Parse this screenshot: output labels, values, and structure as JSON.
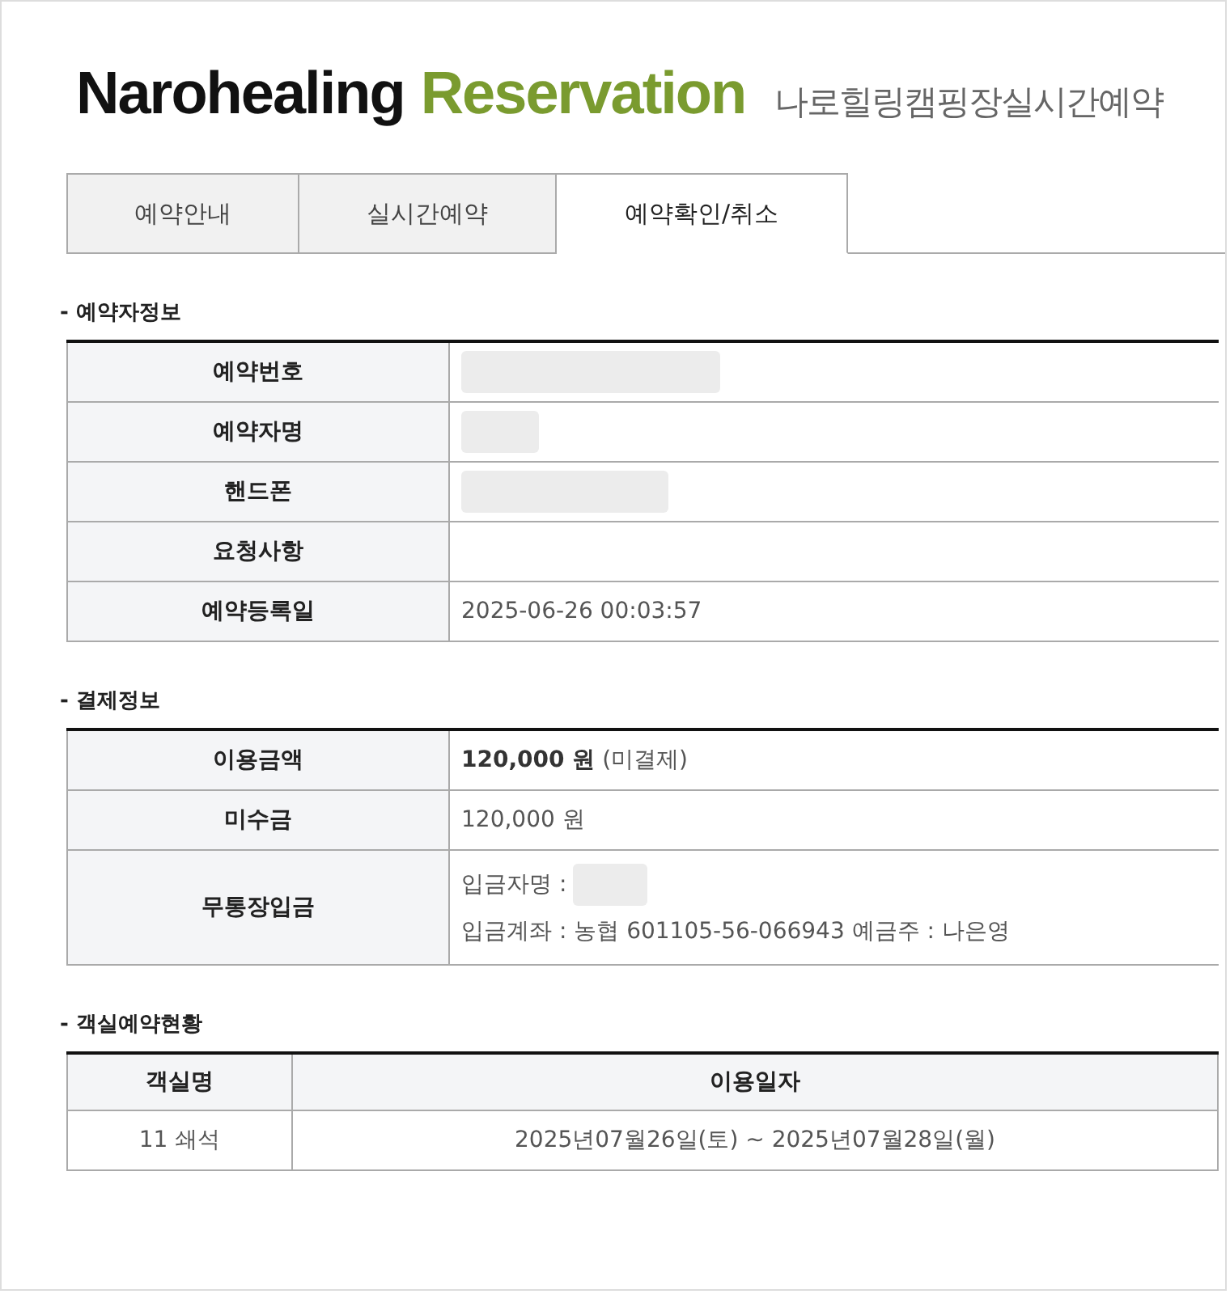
{
  "header": {
    "brand_primary": "Narohealing",
    "brand_secondary": "Reservation",
    "subtitle": "나로힐링캠핑장실시간예약"
  },
  "tabs": [
    {
      "label": "예약안내",
      "selected": false
    },
    {
      "label": "실시간예약",
      "selected": false
    },
    {
      "label": "예약확인/취소",
      "selected": true
    }
  ],
  "sections": [
    {
      "title": "- 예약자정보",
      "kind": "form",
      "rows": [
        {
          "label": "예약번호",
          "kind": "redacted"
        },
        {
          "label": "예약자명",
          "kind": "redacted"
        },
        {
          "label": "핸드폰",
          "kind": "redacted"
        },
        {
          "label": "요청사항",
          "kind": "empty"
        },
        {
          "label": "예약등록일",
          "kind": "text",
          "value": "2025-06-26 00:03:57"
        }
      ]
    },
    {
      "title": "- 결제정보",
      "kind": "form",
      "rows": [
        {
          "label": "이용금액",
          "kind": "text",
          "value": "**120,000 원** (미결제)"
        },
        {
          "label": "미수금",
          "kind": "text",
          "value": "120,000 원"
        },
        {
          "label": "무통장입금",
          "kind": "lines",
          "lines": [
            {
              "kind": "redacted",
              "text": "입금자명 :"
            },
            {
              "kind": "text",
              "text": "입금계좌 : 농협 601105-56-066943 예금주 : 나은영"
            }
          ]
        }
      ]
    },
    {
      "title": "- 객실예약현황",
      "kind": "grid",
      "columns": [
        "객실명",
        "이용일자"
      ],
      "rows": [
        [
          "11 쇄석",
          "2025년07월26일(토) ~ 2025년07월28일(월)"
        ]
      ]
    }
  ]
}
